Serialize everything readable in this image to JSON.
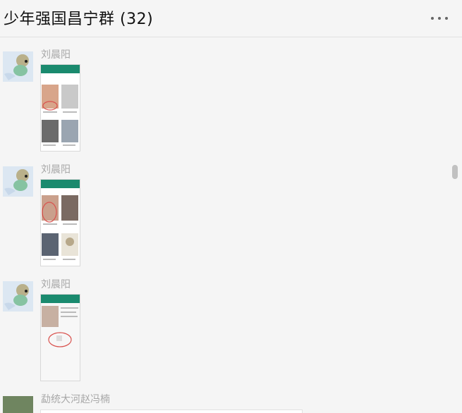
{
  "window": {
    "title": "少年强国昌宁群 (32)"
  },
  "messages": [
    {
      "sender": "刘晨阳",
      "content": "screenshot-image",
      "marker": "red-circle"
    },
    {
      "sender": "刘晨阳",
      "content": "screenshot-image",
      "marker": "red-circle"
    },
    {
      "sender": "刘晨阳",
      "content": "screenshot-image",
      "marker": "red-circle"
    },
    {
      "sender": "勐统大河赵冯楠",
      "content": "message-bubble"
    }
  ],
  "icons": {
    "more": "more-dots-icon",
    "avatar": "cartoon-avatar-icon"
  },
  "colors": {
    "accent": "#1a8a6e",
    "background": "#f5f5f5",
    "marker": "#d9534f"
  }
}
